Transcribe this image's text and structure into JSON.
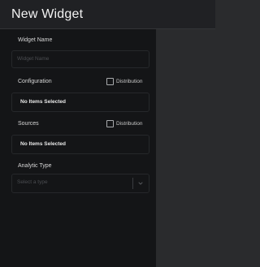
{
  "window": {
    "title": "New Widget"
  },
  "form": {
    "widget_name": {
      "label": "Widget Name",
      "placeholder": "Widget Name",
      "value": ""
    },
    "configuration": {
      "label": "Configuration",
      "distribution_label": "Distribution",
      "distribution_checked": false,
      "empty_text": "No Items Selected"
    },
    "sources": {
      "label": "Sources",
      "distribution_label": "Distribution",
      "distribution_checked": false,
      "empty_text": "No Items Selected"
    },
    "analytic_type": {
      "label": "Analytic Type",
      "placeholder": "Select a type",
      "selected": ""
    }
  },
  "icons": {
    "dropdown": "chevron-down-icon"
  },
  "colors": {
    "panel_bg": "#141517",
    "header_bg": "#202124",
    "preview_bg": "#2a2b2d",
    "text": "#f2f2f2",
    "muted": "#4b4d51"
  }
}
